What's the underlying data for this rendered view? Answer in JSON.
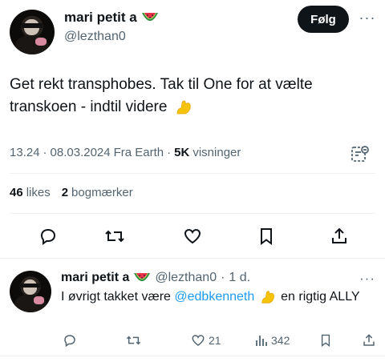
{
  "tweet": {
    "author": {
      "display_name": "mari petit a",
      "handle": "@lezthan0",
      "emoji": "watermelon-icon"
    },
    "follow_label": "Følg",
    "more_label": "···",
    "text": "Get rekt transphobes. Tak til One for at vælte transkoen - indtil videre",
    "text_emoji": "flexed-biceps-icon",
    "time": "13.24",
    "date": "08.03.2024",
    "location": "Fra Earth",
    "views_count": "5K",
    "views_label": "visninger",
    "likes_count": "46",
    "likes_label": "likes",
    "bookmarks_count": "2",
    "bookmarks_label": "bogmærker"
  },
  "reply": {
    "author": {
      "display_name": "mari petit a",
      "handle": "@lezthan0",
      "emoji": "watermelon-icon"
    },
    "age": "1 d.",
    "text_before": "I øvrigt takket være ",
    "mention": "@edbkenneth",
    "text_after": " en rigtig ALLY",
    "more_label": "···",
    "likes": "21",
    "views": "342"
  },
  "colors": {
    "text_primary": "#0f1419",
    "text_secondary": "#536471",
    "accent": "#1d9bf0",
    "divider": "#eff3f4"
  }
}
